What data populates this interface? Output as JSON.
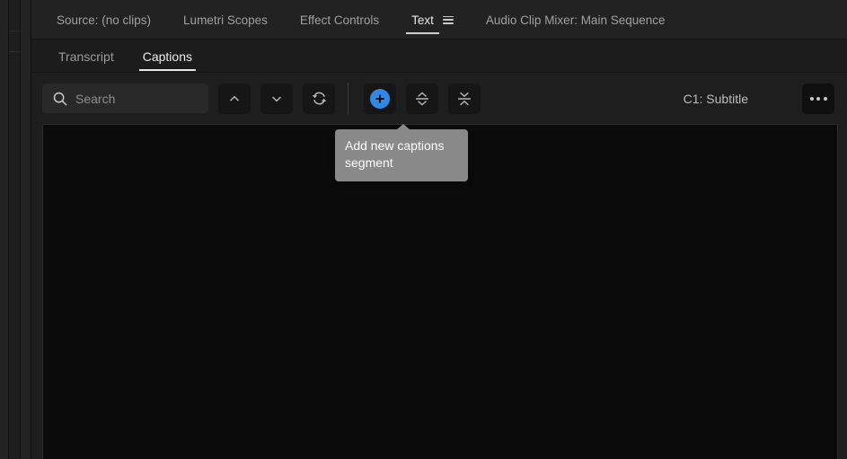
{
  "window": {
    "panel_tabs": [
      {
        "label": "Source: (no clips)",
        "active": false,
        "has_menu": false
      },
      {
        "label": "Lumetri Scopes",
        "active": false,
        "has_menu": false
      },
      {
        "label": "Effect Controls",
        "active": false,
        "has_menu": false
      },
      {
        "label": "Text",
        "active": true,
        "has_menu": true
      },
      {
        "label": "Audio Clip Mixer: Main Sequence",
        "active": false,
        "has_menu": false
      }
    ],
    "panel_menu_icon": "hamburger-menu-icon"
  },
  "subtabs": [
    {
      "label": "Transcript",
      "active": false
    },
    {
      "label": "Captions",
      "active": true
    }
  ],
  "toolbar": {
    "search": {
      "icon": "search-icon",
      "placeholder": "Search",
      "value": ""
    },
    "buttons": [
      {
        "name": "previous-caption-button",
        "icon": "chevron-up-icon",
        "label": ""
      },
      {
        "name": "next-caption-button",
        "icon": "chevron-down-icon",
        "label": ""
      },
      {
        "name": "refresh-captions-button",
        "icon": "refresh-icon",
        "label": ""
      },
      {
        "name": "add-captions-segment-button",
        "icon": "plus-circle-icon",
        "label": ""
      },
      {
        "name": "split-captions-button",
        "icon": "split-icon",
        "label": ""
      },
      {
        "name": "merge-captions-button",
        "icon": "merge-icon",
        "label": ""
      }
    ],
    "track_label": "C1: Subtitle",
    "more_options": {
      "name": "more-options-button",
      "icon": "ellipsis-icon"
    }
  },
  "tooltip": {
    "visible": true,
    "text": "Add new captions segment",
    "target": "add-captions-segment-button"
  },
  "captions_area": {
    "items": [],
    "empty": true
  },
  "colors": {
    "accent_blue": "#2f8ae6",
    "panel_bg": "#1e1e1e",
    "tabbar_bg": "#222222",
    "content_bg": "#0b0b0b",
    "tooltip_bg": "#898989",
    "text_primary": "#e8e8e8",
    "text_muted": "#9a9a9a"
  }
}
